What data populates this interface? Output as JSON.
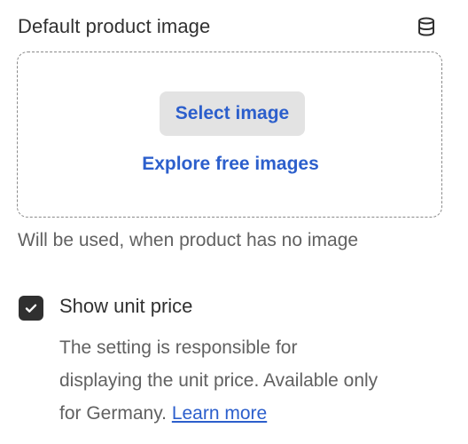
{
  "section": {
    "title": "Default product image",
    "icon": "database-icon"
  },
  "dropzone": {
    "select_button": "Select image",
    "explore_link": "Explore free images"
  },
  "help_text": "Will be used, when product has no image",
  "unit_price": {
    "checked": true,
    "label": "Show unit price",
    "description_line1": "The setting is responsible for",
    "description_line2": "displaying the unit price. Available only",
    "description_line3": "for Germany.",
    "learn_more": "Learn more"
  },
  "colors": {
    "accent": "#2c5fcc",
    "text": "#303030",
    "muted": "#616161"
  }
}
